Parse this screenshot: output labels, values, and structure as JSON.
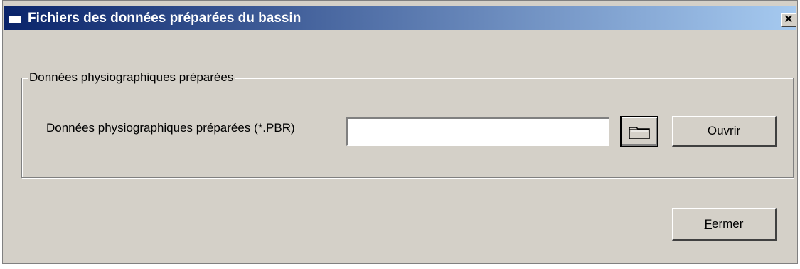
{
  "window": {
    "title": "Fichiers des données préparées du bassin",
    "close_symbol": "✕",
    "title_icon": "window-icon",
    "colors": {
      "titlebar_start": "#0a246a",
      "titlebar_end": "#a6caf0",
      "face": "#d4d0c8"
    }
  },
  "group": {
    "label": "Données physiographiques préparées"
  },
  "field": {
    "label": "Données physiographiques préparées (*.PBR)",
    "value": "",
    "placeholder": "",
    "browse_icon": "folder-icon"
  },
  "buttons": {
    "open_label": "Ouvrir",
    "close_accel": "F",
    "close_rest": "ermer"
  }
}
